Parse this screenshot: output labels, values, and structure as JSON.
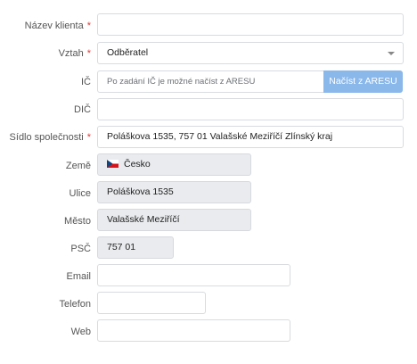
{
  "form": {
    "client_name": {
      "label": "Název klienta",
      "required": true,
      "value": ""
    },
    "relation": {
      "label": "Vztah",
      "required": true,
      "value": "Odběratel"
    },
    "ic": {
      "label": "IČ",
      "placeholder": "Po zadání IČ je možné načíst z ARESU",
      "button": "Načíst z ARESU"
    },
    "dic": {
      "label": "DIČ",
      "value": ""
    },
    "seat": {
      "label": "Sídlo společnosti",
      "required": true,
      "value": "Poláškova 1535, 757 01 Valašské Meziříčí Zlínský kraj"
    },
    "country": {
      "label": "Země",
      "value": "Česko",
      "flag_icon": "czech-flag-icon"
    },
    "street": {
      "label": "Ulice",
      "value": "Poláškova 1535"
    },
    "city": {
      "label": "Město",
      "value": "Valašské Meziříčí"
    },
    "zip": {
      "label": "PSČ",
      "value": "757 01"
    },
    "email": {
      "label": "Email",
      "value": ""
    },
    "phone": {
      "label": "Telefon",
      "value": ""
    },
    "web": {
      "label": "Web",
      "value": ""
    }
  },
  "colors": {
    "required_star": "#e53935",
    "ares_button": "#8ab8ea",
    "readonly_field": "#e9ebee"
  }
}
